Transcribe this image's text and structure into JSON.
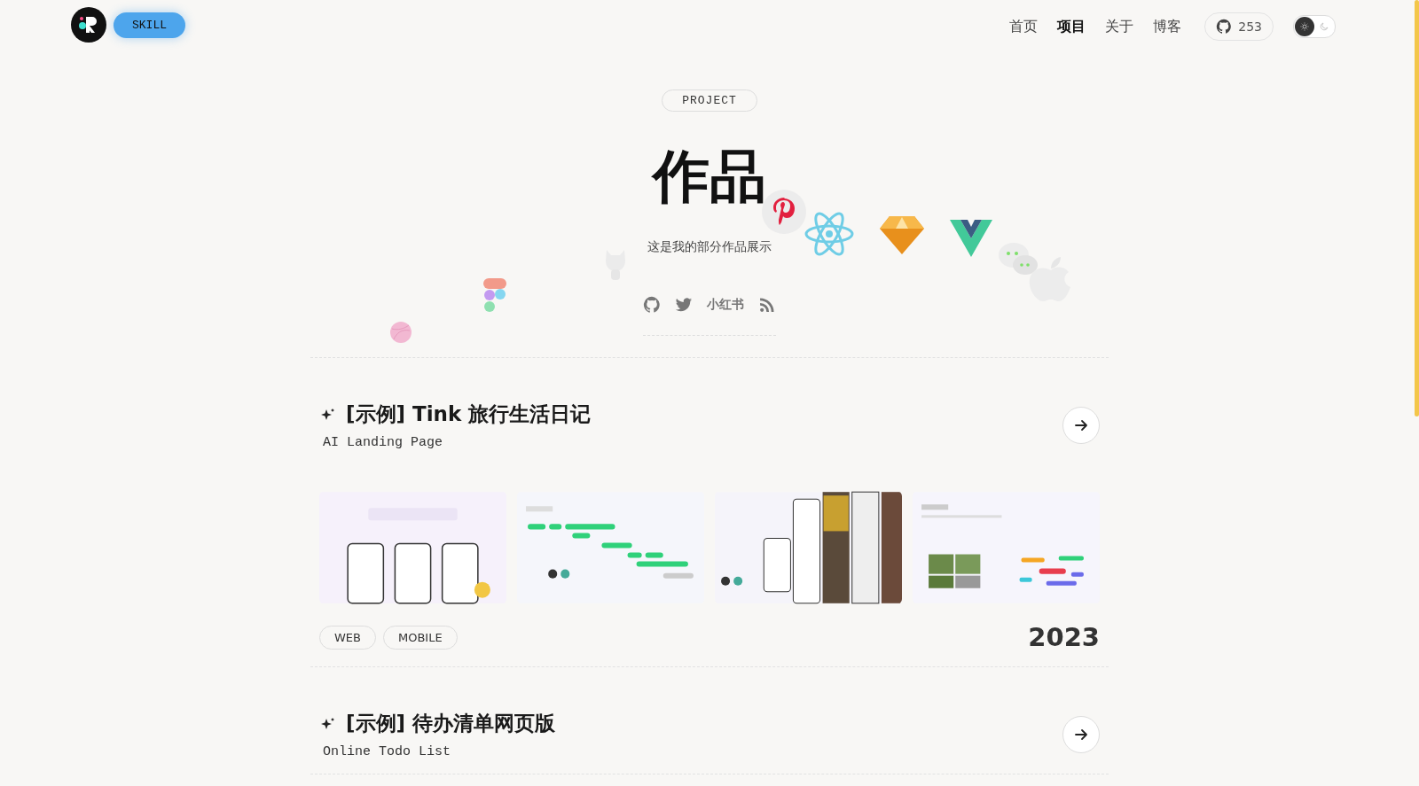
{
  "header": {
    "skill_button": "SKILL",
    "nav": [
      {
        "label": "首页",
        "selected": false
      },
      {
        "label": "项目",
        "selected": true
      },
      {
        "label": "关于",
        "selected": false
      },
      {
        "label": "博客",
        "selected": false
      }
    ],
    "github": {
      "count": "253"
    },
    "theme_toggle": [
      {
        "kind": "sun",
        "selected": true
      },
      {
        "kind": "moon",
        "selected": false
      }
    ]
  },
  "hero": {
    "badge": "PROJECT",
    "title": "作品",
    "subtitle": "这是我的部分作品展示",
    "socials": [
      {
        "kind": "github"
      },
      {
        "kind": "twitter"
      },
      {
        "kind": "text",
        "label": "小红书"
      },
      {
        "kind": "rss"
      }
    ]
  },
  "projects": [
    {
      "title": "[示例] Tink 旅行生活日记",
      "subtitle": "AI Landing Page",
      "images": [
        {
          "kind": "poster"
        },
        {
          "kind": "timeline"
        },
        {
          "kind": "phones"
        },
        {
          "kind": "goals"
        }
      ],
      "tags": [
        "WEB",
        "MOBILE"
      ],
      "year": "2023"
    },
    {
      "title": "[示例] 待办清单网页版",
      "subtitle": "Online Todo List"
    }
  ]
}
